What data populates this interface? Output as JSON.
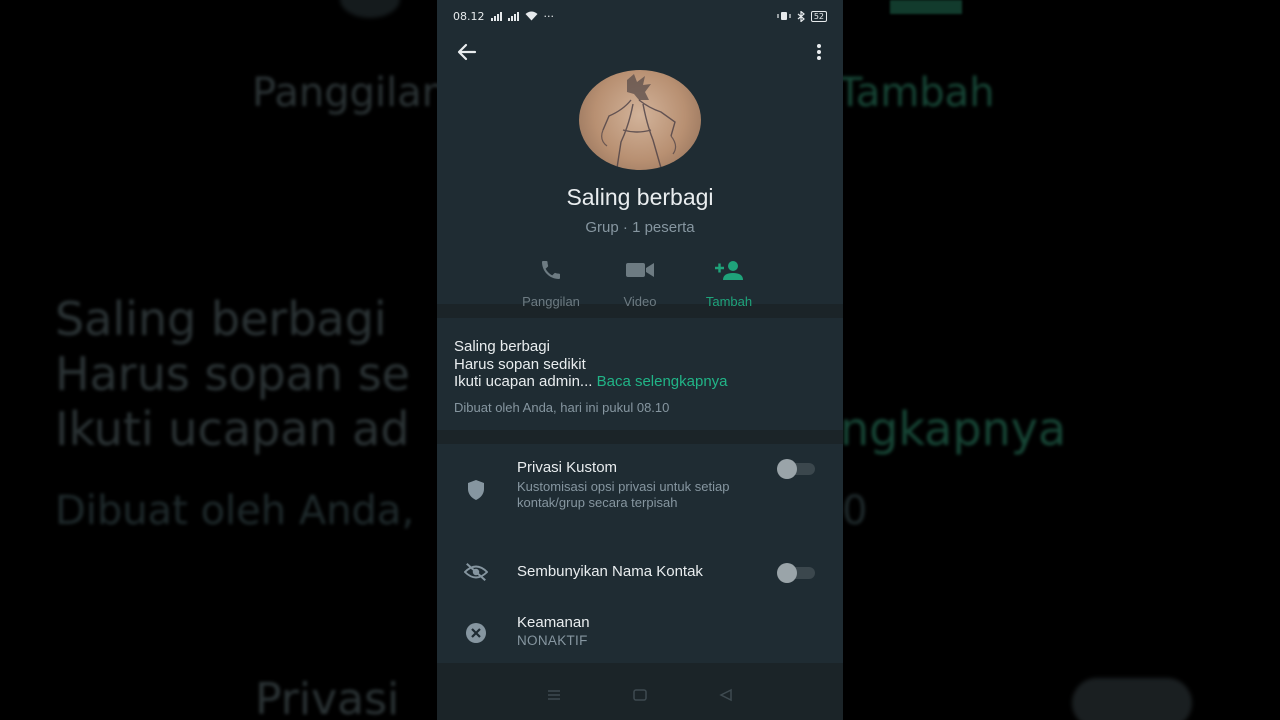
{
  "status_bar": {
    "time": "08.12",
    "extra": "···",
    "battery": "52"
  },
  "group": {
    "name": "Saling berbagi",
    "subtitle": "Grup · 1 peserta"
  },
  "actions": [
    {
      "label": "Panggilan",
      "icon": "phone-icon"
    },
    {
      "label": "Video",
      "icon": "video-icon"
    },
    {
      "label": "Tambah",
      "icon": "add-person-icon"
    }
  ],
  "description": {
    "line1": "Saling berbagi",
    "line2": "Harus sopan sedikit",
    "line3": "Ikuti ucapan admin...",
    "read_more": "Baca selengkapnya",
    "created": "Dibuat oleh Anda, hari ini pukul 08.10"
  },
  "settings": {
    "privacy": {
      "title": "Privasi Kustom",
      "subtitle": "Kustomisasi opsi privasi untuk setiap kontak/grup secara terpisah",
      "enabled": false
    },
    "hide_names": {
      "title": "Sembunyikan Nama Kontak",
      "enabled": false
    },
    "security": {
      "title": "Keamanan",
      "value": "NONAKTIF"
    }
  },
  "background_echo": {
    "top_left": "Panggilan",
    "top_right": "Tambah",
    "line1": "Saling berbagi",
    "line2": "Harus sopan se",
    "line3": "Ikuti ucapan ad",
    "line3_right": "ngkapnya",
    "line4": "Dibuat oleh Anda,",
    "line4_right": "0",
    "bottom": "Privasi"
  },
  "colors": {
    "accent": "#21b487",
    "panel": "#1f2c33",
    "background": "#1b2428"
  }
}
